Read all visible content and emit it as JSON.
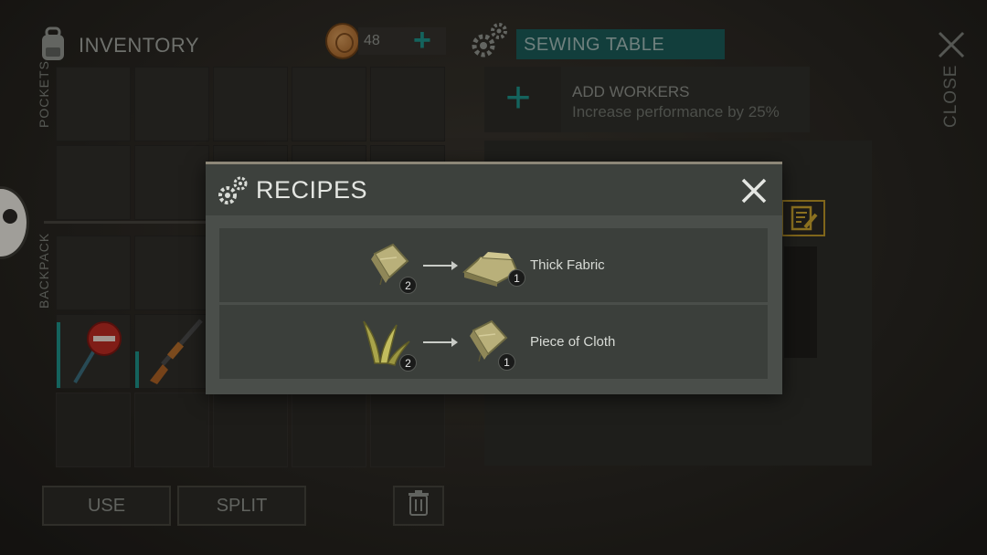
{
  "inventory": {
    "title": "INVENTORY",
    "pockets_label": "POCKETS",
    "backpack_label": "BACKPACK",
    "coins": "48",
    "use_label": "USE",
    "split_label": "SPLIT"
  },
  "sewing_table": {
    "title": "SEWING TABLE",
    "workers_title": "ADD WORKERS",
    "workers_subtitle": "Increase performance by 25%",
    "close_label": "CLOSE"
  },
  "recipes_modal": {
    "title": "RECIPES",
    "recipes": [
      {
        "input_icon": "cloth-piece-icon",
        "input_qty": "2",
        "output_icon": "thick-fabric-icon",
        "output_qty": "1",
        "name": "Thick Fabric"
      },
      {
        "input_icon": "plant-fiber-icon",
        "input_qty": "2",
        "output_icon": "cloth-piece-icon",
        "output_qty": "1",
        "name": "Piece of Cloth"
      }
    ]
  },
  "colors": {
    "accent_teal": "#1e8f86",
    "title_bar_teal": "#1b5956",
    "note_gold": "#b89327"
  }
}
